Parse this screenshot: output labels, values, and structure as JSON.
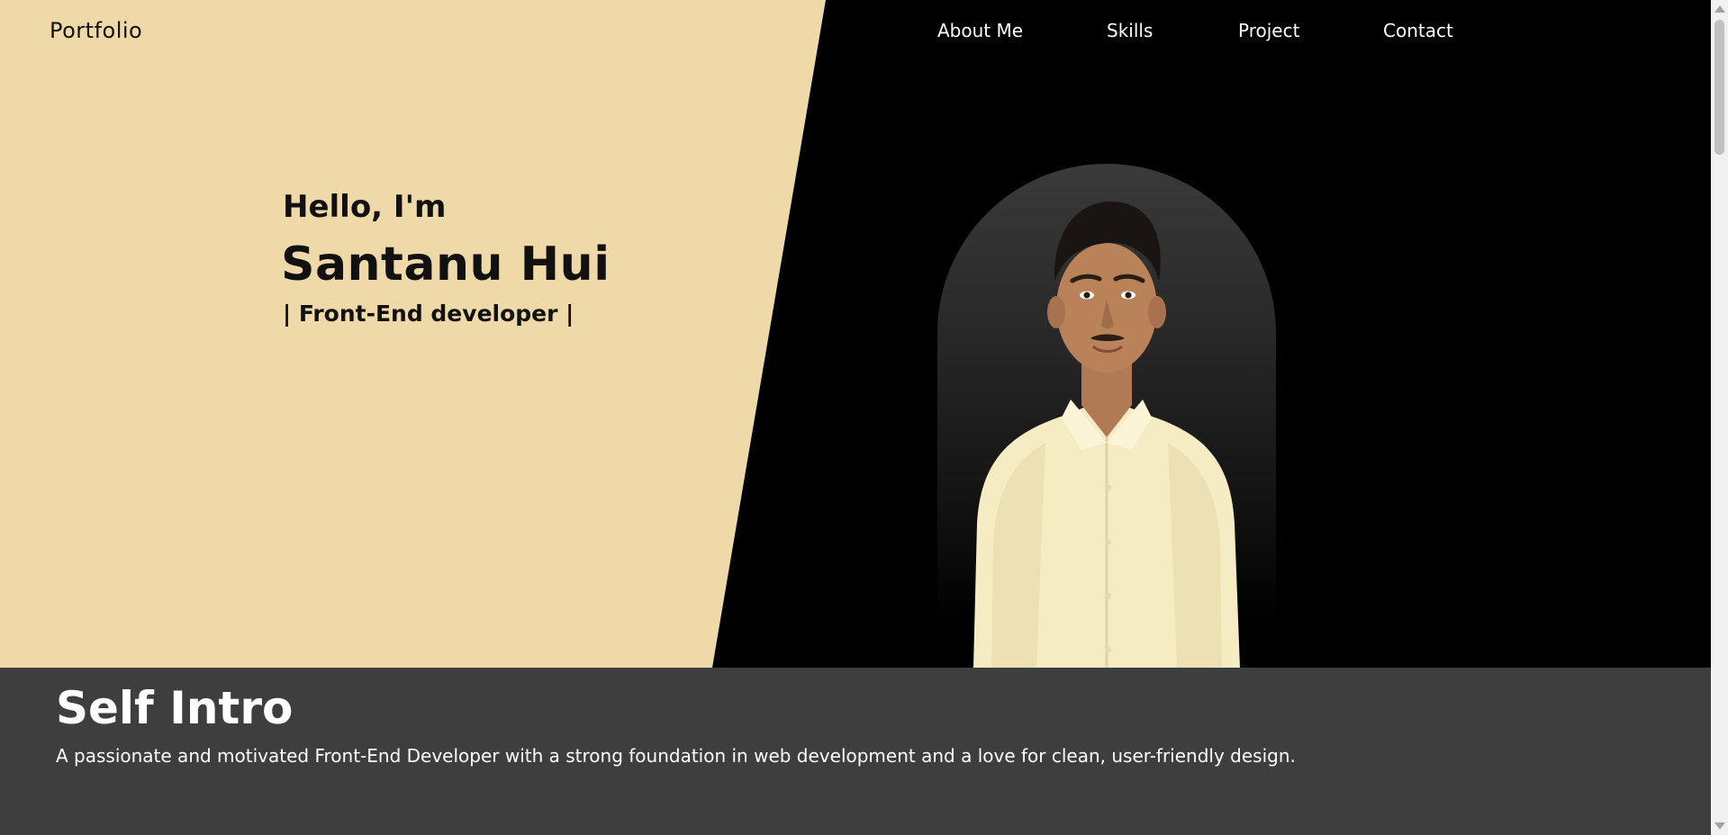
{
  "header": {
    "logo": "Portfolio",
    "nav": [
      {
        "label": "About Me"
      },
      {
        "label": "Skills"
      },
      {
        "label": "Project"
      },
      {
        "label": "Contact"
      }
    ]
  },
  "hero": {
    "greeting": "Hello, I'm",
    "name": "Santanu Hui",
    "role": "| Front-End developer |",
    "portrait_icon": "person-portrait-icon"
  },
  "intro": {
    "title": "Self Intro",
    "text": "A passionate and motivated Front-End Developer with a strong foundation in web development and a love for clean, user-friendly design."
  },
  "colors": {
    "tan": "#f0d9a8",
    "dark": "#000000",
    "intro_bg": "#3f3e3e",
    "shirt": "#f6ecc4"
  }
}
